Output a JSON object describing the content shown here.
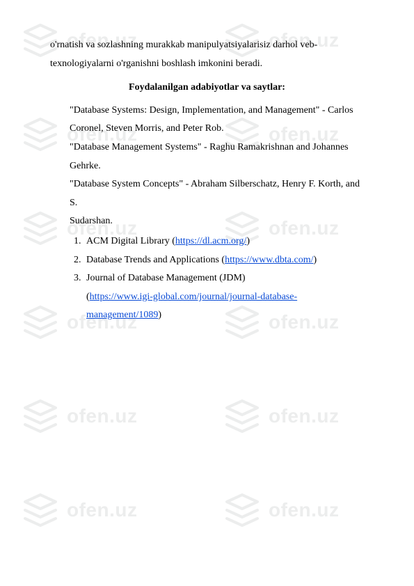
{
  "watermark": {
    "text": "ofen.uz"
  },
  "intro": {
    "line1": "o'rnatish va sozlashning murakkab manipulyatsiyalarisiz darhol veb-",
    "line2": "texnologiyalarni o'rganishni boshlash imkonini beradi."
  },
  "heading": "Foydalanilgan adabiyotlar va saytlar:",
  "refs": {
    "r1a": "\"Database Systems: Design, Implementation, and Management\" - Carlos",
    "r1b": "Coronel, Steven Morris, and Peter Rob.",
    "r2a": "\"Database Management Systems\" - Raghu Ramakrishnan and Johannes",
    "r2b": "Gehrke.",
    "r3a": "\"Database System Concepts\" - Abraham Silberschatz, Henry F. Korth, and S.",
    "r3b": "Sudarshan."
  },
  "list": {
    "i1_pre": "ACM Digital Library (",
    "i1_link": "https://dl.acm.org/",
    "i1_post": ")",
    "i2_pre": "Database Trends and Applications (",
    "i2_link": "https://www.dbta.com/",
    "i2_post": ")",
    "i3_line1": "Journal of Database Management (JDM)",
    "i3_pre": "(",
    "i3_link": "https://www.igi-global.com/journal/journal-database-management/1089",
    "i3_post": ")"
  }
}
